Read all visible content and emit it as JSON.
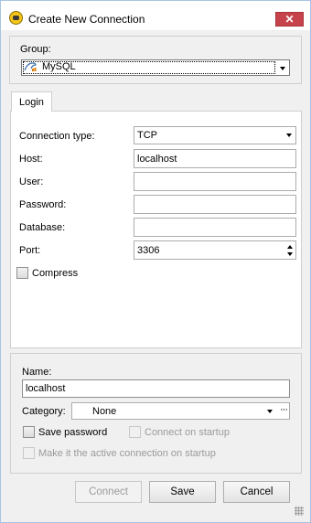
{
  "window": {
    "title": "Create New Connection",
    "close_glyph": "✕"
  },
  "group": {
    "label": "Group:",
    "selected": "MySQL"
  },
  "tabs": [
    {
      "label": "Login"
    }
  ],
  "login": {
    "connection_type_label": "Connection type:",
    "connection_type_value": "TCP",
    "host_label": "Host:",
    "host_value": "localhost",
    "user_label": "User:",
    "user_value": "",
    "password_label": "Password:",
    "password_value": "",
    "database_label": "Database:",
    "database_value": "",
    "port_label": "Port:",
    "port_value": "3306",
    "compress_label": "Compress",
    "compress_checked": false
  },
  "details": {
    "name_label": "Name:",
    "name_value": "localhost",
    "category_label": "Category:",
    "category_value": "None",
    "category_more": "···",
    "save_password_label": "Save password",
    "connect_on_startup_label": "Connect on startup",
    "make_active_label": "Make it the active connection on startup"
  },
  "buttons": {
    "connect": "Connect",
    "save": "Save",
    "cancel": "Cancel"
  },
  "colors": {
    "close_button": "#c7434b",
    "window_border": "#a9c3e3",
    "dialog_bg": "#f0f0f0"
  },
  "icons": {
    "app": "database-connection-icon",
    "group_item": "mysql-dolphin-icon"
  }
}
